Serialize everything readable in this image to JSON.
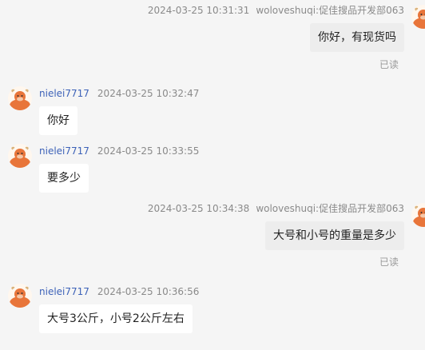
{
  "messages": [
    {
      "direction": "out",
      "timestamp": "2024-03-25 10:31:31",
      "sender": "woloveshuqi:促佳搜品开发部063",
      "text": "你好，有现货吗",
      "status": "已读"
    },
    {
      "direction": "in",
      "sender": "nielei7717",
      "timestamp": "2024-03-25 10:32:47",
      "text": "你好"
    },
    {
      "direction": "in",
      "sender": "nielei7717",
      "timestamp": "2024-03-25 10:33:55",
      "text": "要多少"
    },
    {
      "direction": "out",
      "timestamp": "2024-03-25 10:34:38",
      "sender": "woloveshuqi:促佳搜品开发部063",
      "text": "大号和小号的重量是多少",
      "status": "已读"
    },
    {
      "direction": "in",
      "sender": "nielei7717",
      "timestamp": "2024-03-25 10:36:56",
      "text": "大号3公斤，小号2公斤左右"
    }
  ],
  "colors": {
    "background": "#f5f5f5",
    "incoming_bubble": "#ffffff",
    "outgoing_bubble": "#ededed",
    "sender_name": "#3d62b8",
    "meta_text": "#8a8a8a",
    "avatar_accent": "#e8753a"
  },
  "icons": {
    "avatar": "cartoon-cow-avatar-icon"
  }
}
